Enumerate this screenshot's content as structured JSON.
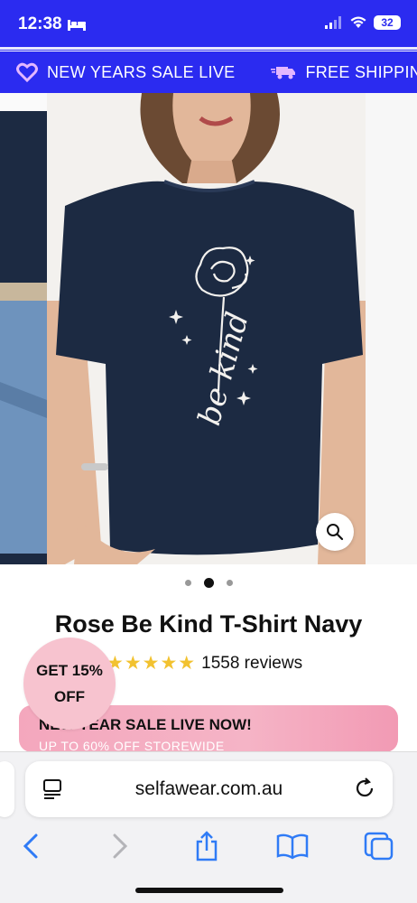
{
  "status_bar": {
    "time": "12:38",
    "battery": "32"
  },
  "announcement": {
    "items": [
      {
        "text": "NEW YEARS SALE LIVE",
        "icon": "heart-icon"
      },
      {
        "text": "FREE SHIPPIN",
        "icon": "truck-icon"
      }
    ]
  },
  "gallery": {
    "print_text": "be kind",
    "slide_count": 3,
    "active_slide": 2
  },
  "product": {
    "title": "Rose Be Kind T-Shirt Navy",
    "rating": 5,
    "stars": "★★★★★",
    "reviews": "1558 reviews"
  },
  "promo": {
    "badge_line1": "GET 15%",
    "badge_line2": "OFF",
    "banner_title": "NEW YEAR SALE LIVE NOW!",
    "banner_subtitle": "UP TO 60% OFF STOREWIDE"
  },
  "browser": {
    "url": "selfawear.com.au"
  },
  "colors": {
    "brand_blue": "#2b2bf0",
    "shirt_navy": "#1c2a42",
    "star_gold": "#f2c230",
    "promo_pink": "#f4a7bd",
    "ios_blue": "#2f7bf6"
  }
}
